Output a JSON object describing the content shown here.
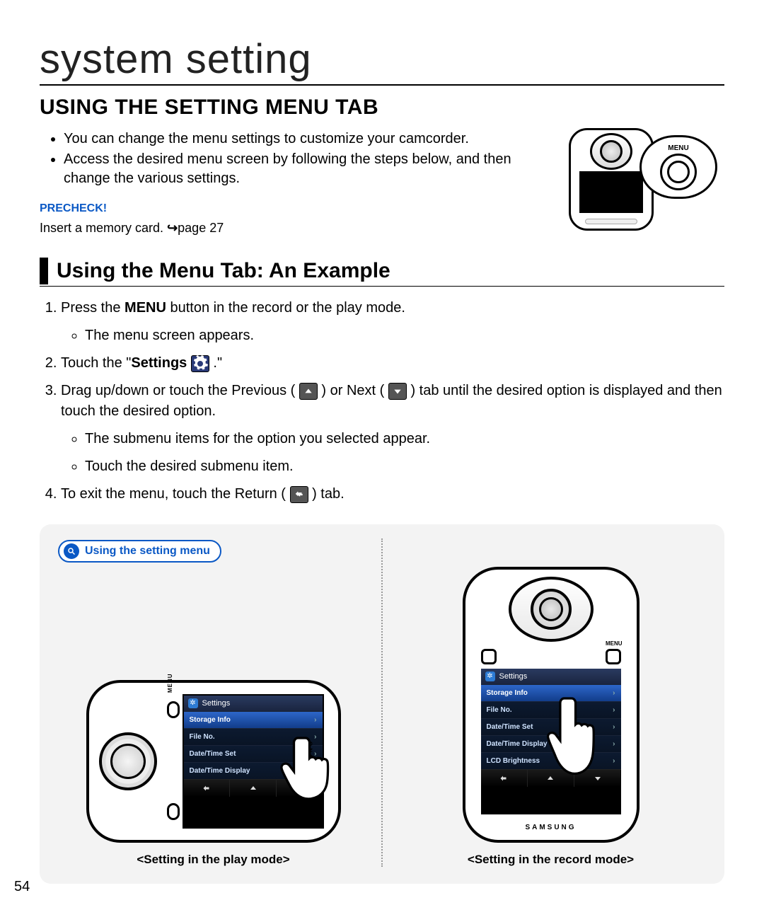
{
  "page_number": "54",
  "chapter_title": "system setting",
  "section_title": "USING THE SETTING MENU TAB",
  "intro_bullets": [
    "You can change the menu settings to customize your camcorder.",
    "Access the desired menu screen by following the steps below, and then change the various settings."
  ],
  "precheck": {
    "label": "PRECHECK!",
    "text_prefix": "Insert a memory card. ",
    "page_ref": "page 27"
  },
  "mini_diagram": {
    "menu_label": "MENU"
  },
  "subheading": "Using the Menu Tab: An Example",
  "steps": {
    "s1": {
      "text_a": "Press the ",
      "bold": "MENU",
      "text_b": " button in the record or the play mode.",
      "sub": [
        "The menu screen appears."
      ]
    },
    "s2": {
      "text_a": "Touch the \"",
      "bold": "Settings",
      "text_b": " .\""
    },
    "s3": {
      "text_a": "Drag up/down or touch the Previous (",
      "mid": ") or Next (",
      "text_b": ") tab until the desired option is displayed and then touch the desired option.",
      "sub": [
        "The submenu items for the option you selected appear.",
        "Touch the desired submenu item."
      ]
    },
    "s4": {
      "text_a": "To exit the menu, touch the Return (",
      "text_b": ") tab."
    }
  },
  "figure": {
    "pill_label": "Using the setting menu",
    "caption_play": "<Setting in the play mode>",
    "caption_record": "<Setting in the record mode>",
    "brand": "SAMSUNG",
    "menu_small": "MENU",
    "lcd": {
      "header": "Settings",
      "items_play": [
        "Storage Info",
        "File No.",
        "Date/Time Set",
        "Date/Time Display"
      ],
      "items_record": [
        "Storage Info",
        "File No.",
        "Date/Time Set",
        "Date/Time Display",
        "LCD Brightness"
      ]
    }
  }
}
